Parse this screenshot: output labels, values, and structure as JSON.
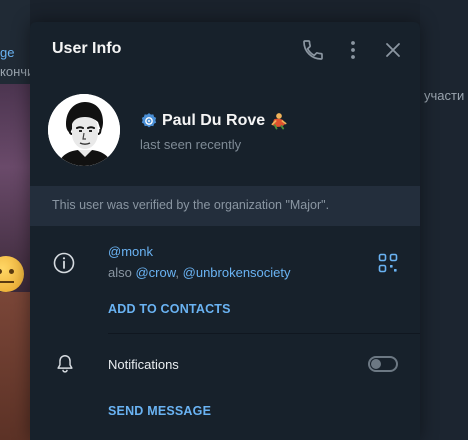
{
  "background": {
    "left_text_1": "ge",
    "left_text_2": "кончи",
    "right_text": "участи"
  },
  "modal": {
    "title": "User Info",
    "header_icons": [
      "phone-icon",
      "more-vertical-icon",
      "close-icon"
    ]
  },
  "profile": {
    "name": "Paul Du Rove",
    "status": "last seen recently",
    "verified_icon": "verified-badge-icon",
    "emoji_status_icon": "emoji-status-icon"
  },
  "verification": {
    "text": "This user was verified by the organization \"Major\"."
  },
  "info": {
    "username": "@monk",
    "also_prefix": "also ",
    "also_usernames": [
      "@crow",
      "@unbrokensociety"
    ],
    "separator": ", ",
    "add_to_contacts": "ADD TO CONTACTS"
  },
  "notifications": {
    "label": "Notifications",
    "enabled": false
  },
  "actions": {
    "send_message": "SEND MESSAGE"
  },
  "colors": {
    "accent": "#6ab3f3",
    "modal_bg": "#17212b",
    "verification_bar": "#232e3c",
    "verified_badge": "#4a8fd6"
  }
}
